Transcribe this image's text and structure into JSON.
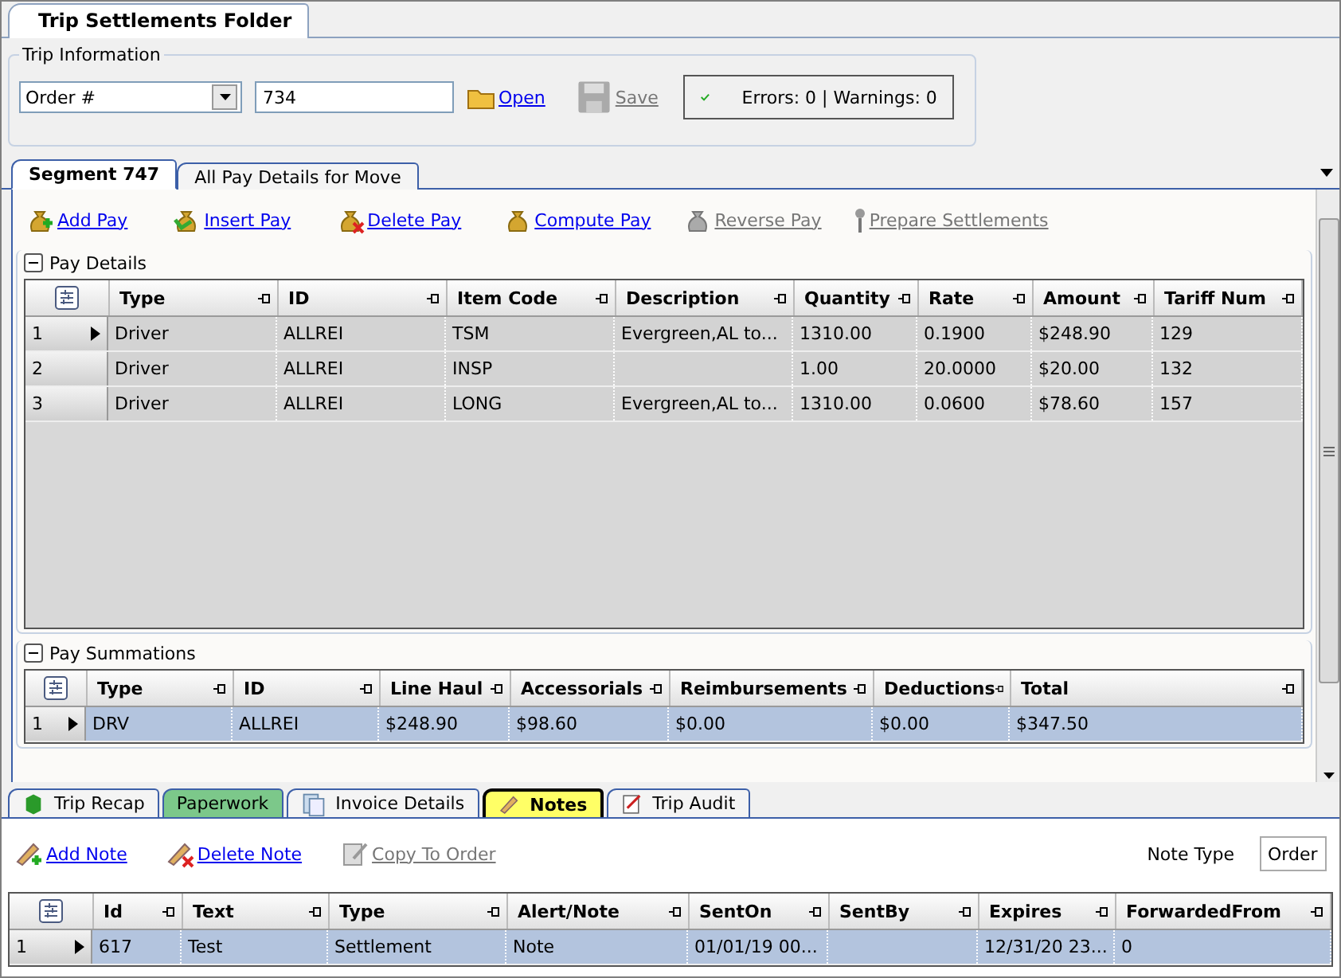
{
  "folder_tab": {
    "label": "Trip Settlements Folder",
    "selected": true
  },
  "trip_information": {
    "title": "Trip Information",
    "lookup_type": "Order #",
    "lookup_value": "734",
    "actions": [
      {
        "label": "Open",
        "disabled": false,
        "kind": "open"
      },
      {
        "label": "Save",
        "disabled": true,
        "kind": "save"
      }
    ],
    "status": "Errors: 0 | Warnings: 0"
  },
  "segment_tabs": [
    {
      "label": "Segment 747",
      "selected": true
    },
    {
      "label": "All Pay Details for Move",
      "selected": false
    }
  ],
  "pay_actions": [
    {
      "label": "Add Pay",
      "disabled": false,
      "kind": "add"
    },
    {
      "label": "Insert Pay",
      "disabled": false,
      "kind": "insert"
    },
    {
      "label": "Delete Pay",
      "disabled": false,
      "kind": "delete"
    },
    {
      "label": "Compute Pay",
      "disabled": false,
      "kind": "compute"
    },
    {
      "label": "Reverse Pay",
      "disabled": true,
      "kind": "reverse"
    },
    {
      "label": "Prepare Settlements",
      "disabled": true,
      "kind": "prepare"
    }
  ],
  "pay_details": {
    "title": "Pay Details",
    "expanded": true,
    "columns": [
      "Type",
      "ID",
      "Item Code",
      "Description",
      "Quantity",
      "Rate",
      "Amount",
      "Tariff Num"
    ],
    "rows": [
      {
        "number": "1",
        "current": true,
        "selected": false,
        "cells": [
          "Driver",
          "ALLREI",
          "TSM",
          "Evergreen,AL to...",
          "1310.00",
          "0.1900",
          "$248.90",
          "129"
        ]
      },
      {
        "number": "2",
        "current": false,
        "selected": false,
        "cells": [
          "Driver",
          "ALLREI",
          "INSP",
          "",
          "1.00",
          "20.0000",
          "$20.00",
          "132"
        ]
      },
      {
        "number": "3",
        "current": false,
        "selected": false,
        "cells": [
          "Driver",
          "ALLREI",
          "LONG",
          "Evergreen,AL to...",
          "1310.00",
          "0.0600",
          "$78.60",
          "157"
        ]
      }
    ]
  },
  "pay_summations": {
    "title": "Pay Summations",
    "expanded": true,
    "columns": [
      "Type",
      "ID",
      "Line Haul",
      "Accessorials",
      "Reimbursements",
      "Deductions",
      "Total"
    ],
    "rows": [
      {
        "number": "1",
        "current": true,
        "selected": true,
        "cells": [
          "DRV",
          "ALLREI",
          "$248.90",
          "$98.60",
          "$0.00",
          "$0.00",
          "$347.50"
        ]
      }
    ]
  },
  "bottom_tabs": [
    {
      "label": "Trip Recap",
      "selected": false,
      "kind": "recap"
    },
    {
      "label": "Paperwork",
      "selected": false,
      "kind": "paperwork",
      "color": "#7cc88a"
    },
    {
      "label": "Invoice Details",
      "selected": false,
      "kind": "invoice"
    },
    {
      "label": "Notes",
      "selected": true,
      "kind": "notes"
    },
    {
      "label": "Trip Audit",
      "selected": false,
      "kind": "audit"
    }
  ],
  "note_actions": [
    {
      "label": "Add Note",
      "disabled": false,
      "kind": "add"
    },
    {
      "label": "Delete Note",
      "disabled": false,
      "kind": "delete"
    },
    {
      "label": "Copy To Order",
      "disabled": true,
      "kind": "copy"
    }
  ],
  "note_type": {
    "label": "Note Type",
    "value": "Order"
  },
  "notes": {
    "columns": [
      "Id",
      "Text",
      "Type",
      "Alert/Note",
      "SentOn",
      "SentBy",
      "Expires",
      "ForwardedFrom"
    ],
    "rows": [
      {
        "number": "1",
        "current": true,
        "selected": true,
        "cells": [
          "617",
          "Test",
          "Settlement",
          "Note",
          "01/01/19    00...",
          "",
          "12/31/20    23...",
          "0"
        ]
      }
    ]
  }
}
